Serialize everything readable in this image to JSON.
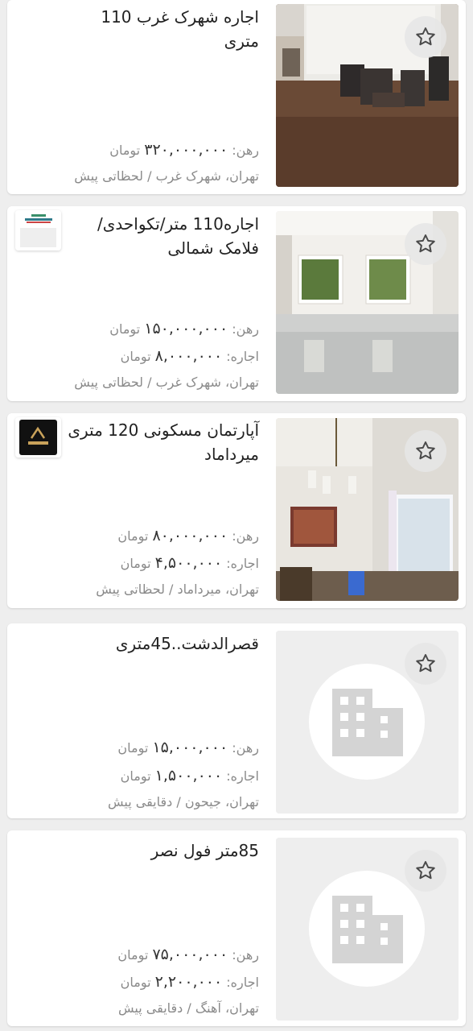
{
  "listings": [
    {
      "title": "اجاره شهرک غرب 110 متری",
      "deposit_label": "رهن:",
      "deposit_value": "۳۲۰,۰۰۰,۰۰۰",
      "rent_label": "",
      "rent_value": "",
      "currency": "تومان",
      "location": "تهران، شهرک غرب / لحظاتی پیش",
      "has_photo": true,
      "has_logo": false
    },
    {
      "title": "اجاره110 متر/تکواحدی/ فلامک شمالی",
      "deposit_label": "رهن:",
      "deposit_value": "۱۵۰,۰۰۰,۰۰۰",
      "rent_label": "اجاره:",
      "rent_value": "۸,۰۰۰,۰۰۰",
      "currency": "تومان",
      "location": "تهران، شهرک غرب / لحظاتی پیش",
      "has_photo": true,
      "has_logo": true
    },
    {
      "title": "آپارتمان مسکونی 120 متری میرداماد",
      "deposit_label": "رهن:",
      "deposit_value": "۸۰,۰۰۰,۰۰۰",
      "rent_label": "اجاره:",
      "rent_value": "۴,۵۰۰,۰۰۰",
      "currency": "تومان",
      "location": "تهران، میرداماد / لحظاتی پیش",
      "has_photo": true,
      "has_logo": true
    },
    {
      "title": "قصرالدشت..45متری",
      "deposit_label": "رهن:",
      "deposit_value": "۱۵,۰۰۰,۰۰۰",
      "rent_label": "اجاره:",
      "rent_value": "۱,۵۰۰,۰۰۰",
      "currency": "تومان",
      "location": "تهران، جیحون / دقایقی پیش",
      "has_photo": false,
      "has_logo": false
    },
    {
      "title": "85متر فول نصر",
      "deposit_label": "رهن:",
      "deposit_value": "۷۵,۰۰۰,۰۰۰",
      "rent_label": "اجاره:",
      "rent_value": "۲,۲۰۰,۰۰۰",
      "currency": "تومان",
      "location": "تهران، آهنگ / دقایقی پیش",
      "has_photo": false,
      "has_logo": false
    }
  ],
  "icons": {
    "favorite": "star-outline-icon",
    "placeholder": "building-placeholder-icon"
  },
  "colors": {
    "background": "#eeeeee",
    "card": "#ffffff",
    "muted_text": "#8a8a8a",
    "title_text": "#222222"
  }
}
